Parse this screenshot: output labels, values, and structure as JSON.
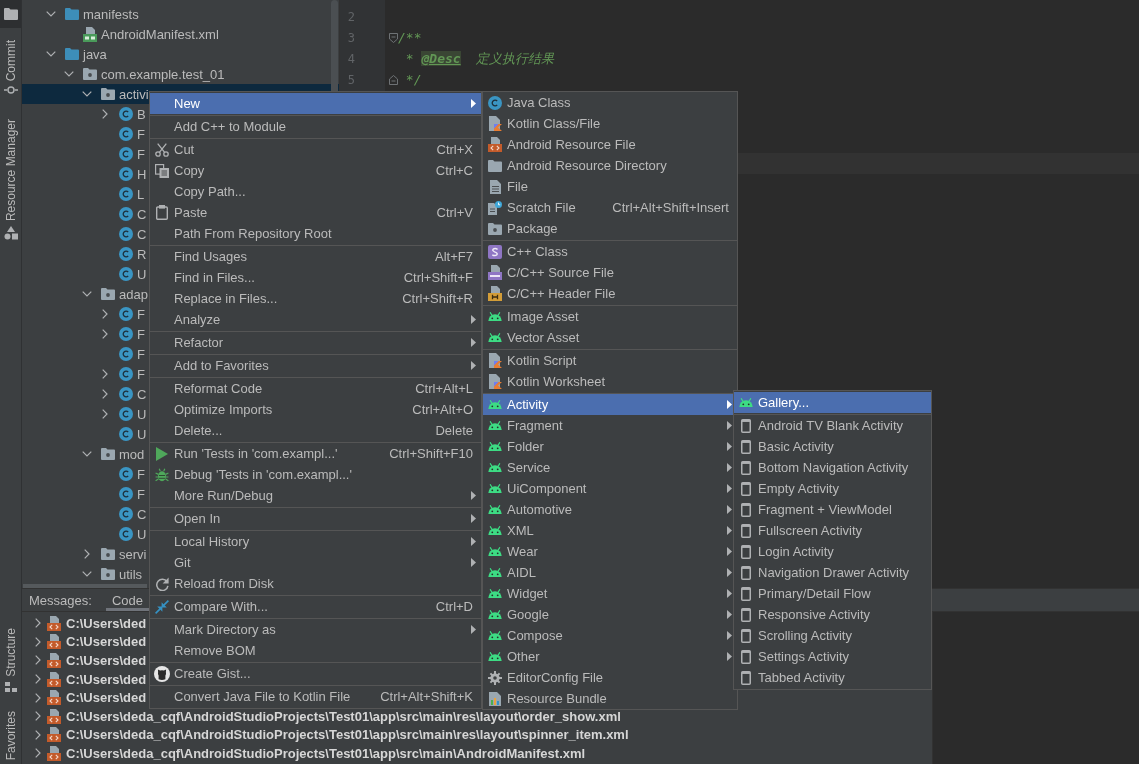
{
  "tool_strip": {
    "top": [
      {
        "kind": "project",
        "selected": true
      },
      {
        "kind": "commit",
        "label": "Commit",
        "selected": false
      },
      {
        "kind": "resources",
        "label": "Resource Manager",
        "selected": false
      }
    ],
    "bottom": [
      {
        "kind": "structure",
        "label": "Structure",
        "selected": false
      },
      {
        "kind": "favorites",
        "label": "Favorites",
        "selected": false
      }
    ]
  },
  "project_tree": {
    "items": [
      {
        "label": "manifests",
        "kind": "folder",
        "expanded": true,
        "selected": false,
        "children": [
          {
            "label": "AndroidManifest.xml",
            "kind": "manifest",
            "selected": false
          }
        ]
      },
      {
        "label": "java",
        "kind": "folder",
        "expanded": true,
        "selected": false,
        "children": [
          {
            "label": "com.example.test_01",
            "kind": "package",
            "expanded": true,
            "selected": false,
            "children": [
              {
                "label": "activi",
                "kind": "package",
                "expanded": true,
                "selected": true,
                "children": [
                  {
                    "label": "B",
                    "kind": "class",
                    "expanded": false,
                    "selected": false
                  },
                  {
                    "label": "F",
                    "kind": "class",
                    "selected": false
                  },
                  {
                    "label": "F",
                    "kind": "class",
                    "selected": false
                  },
                  {
                    "label": "H",
                    "kind": "class",
                    "selected": false
                  },
                  {
                    "label": "L",
                    "kind": "class",
                    "selected": false
                  },
                  {
                    "label": "C",
                    "kind": "class",
                    "selected": false
                  },
                  {
                    "label": "C",
                    "kind": "class",
                    "selected": false
                  },
                  {
                    "label": "R",
                    "kind": "class",
                    "selected": false
                  },
                  {
                    "label": "U",
                    "kind": "class",
                    "selected": false
                  }
                ]
              },
              {
                "label": "adap",
                "kind": "package",
                "expanded": true,
                "selected": false,
                "children": [
                  {
                    "label": "F",
                    "kind": "class",
                    "expanded": false,
                    "selected": false
                  },
                  {
                    "label": "F",
                    "kind": "class",
                    "expanded": false,
                    "selected": false
                  },
                  {
                    "label": "F",
                    "kind": "class",
                    "selected": false
                  },
                  {
                    "label": "F",
                    "kind": "class",
                    "expanded": false,
                    "selected": false
                  },
                  {
                    "label": "C",
                    "kind": "class",
                    "expanded": false,
                    "selected": false
                  },
                  {
                    "label": "U",
                    "kind": "class",
                    "expanded": false,
                    "selected": false
                  },
                  {
                    "label": "U",
                    "kind": "class",
                    "selected": false
                  }
                ]
              },
              {
                "label": "mod",
                "kind": "package",
                "expanded": true,
                "selected": false,
                "children": [
                  {
                    "label": "F",
                    "kind": "class",
                    "selected": false
                  },
                  {
                    "label": "F",
                    "kind": "class",
                    "selected": false
                  },
                  {
                    "label": "C",
                    "kind": "class",
                    "selected": false
                  },
                  {
                    "label": "U",
                    "kind": "class",
                    "selected": false
                  }
                ]
              },
              {
                "label": "servi",
                "kind": "package",
                "expanded": false,
                "selected": false
              },
              {
                "label": "utils",
                "kind": "package",
                "expanded": true,
                "selected": false
              }
            ]
          }
        ]
      }
    ]
  },
  "editor": {
    "lines": [
      {
        "number": "2",
        "fold_start": false,
        "fold_end": false
      },
      {
        "number": "3",
        "fold_start": true,
        "fold_end": false,
        "segments": [
          {
            "text": "/**",
            "kind": "comment"
          }
        ]
      },
      {
        "number": "4",
        "fold_start": false,
        "fold_end": false,
        "segments": [
          {
            "text": " * ",
            "kind": "comment"
          },
          {
            "text": "@Desc",
            "kind": "tag"
          },
          {
            "text": "  定义执行结果",
            "kind": "comment"
          }
        ]
      },
      {
        "number": "5",
        "fold_start": false,
        "fold_end": true,
        "segments": [
          {
            "text": " */",
            "kind": "comment"
          }
        ]
      }
    ]
  },
  "messages_panel": {
    "title": "Messages:",
    "tabs": [
      {
        "label": "Code",
        "selected": true
      }
    ],
    "rows": [
      {
        "text": "C:\\Users\\ded",
        "expanded": false
      },
      {
        "text": "C:\\Users\\ded",
        "expanded": false
      },
      {
        "text": "C:\\Users\\ded",
        "expanded": false
      },
      {
        "text": "C:\\Users\\ded",
        "expanded": false
      },
      {
        "text": "C:\\Users\\ded",
        "expanded": false
      },
      {
        "text": "C:\\Users\\deda_cqf\\AndroidStudioProjects\\Test01\\app\\src\\main\\res\\layout\\order_show.xml",
        "expanded": false
      },
      {
        "text": "C:\\Users\\deda_cqf\\AndroidStudioProjects\\Test01\\app\\src\\main\\res\\layout\\spinner_item.xml",
        "expanded": false
      },
      {
        "text": "C:\\Users\\deda_cqf\\AndroidStudioProjects\\Test01\\app\\src\\main\\AndroidManifest.xml",
        "expanded": false
      }
    ]
  },
  "context_menu": {
    "groups": [
      {
        "items": [
          {
            "label": "New",
            "kind": "plain",
            "selected": true,
            "submenu": true
          }
        ]
      },
      {
        "items": [
          {
            "label": "Add C++ to Module",
            "kind": "plain",
            "selected": false,
            "submenu": false
          }
        ]
      },
      {
        "items": [
          {
            "label": "Cut",
            "kind": "cut",
            "shortcut": "Ctrl+X",
            "selected": false,
            "submenu": false
          },
          {
            "label": "Copy",
            "kind": "copy",
            "shortcut": "Ctrl+C",
            "selected": false,
            "submenu": false
          },
          {
            "label": "Copy Path...",
            "kind": "plain",
            "selected": false,
            "submenu": false
          },
          {
            "label": "Paste",
            "kind": "paste",
            "shortcut": "Ctrl+V",
            "selected": false,
            "submenu": false
          },
          {
            "label": "Path From Repository Root",
            "kind": "plain",
            "selected": false,
            "submenu": false
          }
        ]
      },
      {
        "items": [
          {
            "label": "Find Usages",
            "kind": "plain",
            "shortcut": "Alt+F7",
            "selected": false,
            "submenu": false
          },
          {
            "label": "Find in Files...",
            "kind": "plain",
            "shortcut": "Ctrl+Shift+F",
            "selected": false,
            "submenu": false
          },
          {
            "label": "Replace in Files...",
            "kind": "plain",
            "shortcut": "Ctrl+Shift+R",
            "selected": false,
            "submenu": false
          },
          {
            "label": "Analyze",
            "kind": "plain",
            "selected": false,
            "submenu": true
          }
        ]
      },
      {
        "items": [
          {
            "label": "Refactor",
            "kind": "plain",
            "selected": false,
            "submenu": true
          }
        ]
      },
      {
        "items": [
          {
            "label": "Add to Favorites",
            "kind": "plain",
            "selected": false,
            "submenu": true
          }
        ]
      },
      {
        "items": [
          {
            "label": "Reformat Code",
            "kind": "plain",
            "shortcut": "Ctrl+Alt+L",
            "selected": false,
            "submenu": false
          },
          {
            "label": "Optimize Imports",
            "kind": "plain",
            "shortcut": "Ctrl+Alt+O",
            "selected": false,
            "submenu": false
          },
          {
            "label": "Delete...",
            "kind": "plain",
            "shortcut": "Delete",
            "selected": false,
            "submenu": false
          }
        ]
      },
      {
        "items": [
          {
            "label": "Run 'Tests in 'com.exampl...'",
            "kind": "run",
            "shortcut": "Ctrl+Shift+F10",
            "selected": false,
            "submenu": false
          },
          {
            "label": "Debug 'Tests in 'com.exampl...'",
            "kind": "debug",
            "selected": false,
            "submenu": false
          },
          {
            "label": "More Run/Debug",
            "kind": "plain",
            "selected": false,
            "submenu": true
          }
        ]
      },
      {
        "items": [
          {
            "label": "Open In",
            "kind": "plain",
            "selected": false,
            "submenu": true
          }
        ]
      },
      {
        "items": [
          {
            "label": "Local History",
            "kind": "plain",
            "selected": false,
            "submenu": true
          },
          {
            "label": "Git",
            "kind": "plain",
            "selected": false,
            "submenu": true
          },
          {
            "label": "Reload from Disk",
            "kind": "reload",
            "selected": false,
            "submenu": false
          }
        ]
      },
      {
        "items": [
          {
            "label": "Compare With...",
            "kind": "compare",
            "shortcut": "Ctrl+D",
            "selected": false,
            "submenu": false
          }
        ]
      },
      {
        "items": [
          {
            "label": "Mark Directory as",
            "kind": "plain",
            "selected": false,
            "submenu": true
          },
          {
            "label": "Remove BOM",
            "kind": "plain",
            "selected": false,
            "submenu": false
          }
        ]
      },
      {
        "items": [
          {
            "label": "Create Gist...",
            "kind": "gist",
            "selected": false,
            "submenu": false
          }
        ]
      },
      {
        "items": [
          {
            "label": "Convert Java File to Kotlin File",
            "kind": "plain",
            "shortcut": "Ctrl+Alt+Shift+K",
            "selected": false,
            "submenu": false
          }
        ]
      }
    ]
  },
  "new_submenu": {
    "groups": [
      {
        "items": [
          {
            "label": "Java Class",
            "kind": "class",
            "selected": false,
            "submenu": false
          },
          {
            "label": "Kotlin Class/File",
            "kind": "kotlin",
            "selected": false,
            "submenu": false
          },
          {
            "label": "Android Resource File",
            "kind": "resource",
            "selected": false,
            "submenu": false
          },
          {
            "label": "Android Resource Directory",
            "kind": "folder",
            "selected": false,
            "submenu": false
          },
          {
            "label": "File",
            "kind": "file",
            "selected": false,
            "submenu": false
          },
          {
            "label": "Scratch File",
            "kind": "scratch",
            "shortcut": "Ctrl+Alt+Shift+Insert",
            "selected": false,
            "submenu": false
          },
          {
            "label": "Package",
            "kind": "package",
            "selected": false,
            "submenu": false
          }
        ]
      },
      {
        "items": [
          {
            "label": "C++ Class",
            "kind": "cppclass",
            "selected": false,
            "submenu": false
          },
          {
            "label": "C/C++ Source File",
            "kind": "cppsource",
            "selected": false,
            "submenu": false
          },
          {
            "label": "C/C++ Header File",
            "kind": "cppheader",
            "selected": false,
            "submenu": false
          }
        ]
      },
      {
        "items": [
          {
            "label": "Image Asset",
            "kind": "android",
            "selected": false,
            "submenu": false
          },
          {
            "label": "Vector Asset",
            "kind": "android",
            "selected": false,
            "submenu": false
          }
        ]
      },
      {
        "items": [
          {
            "label": "Kotlin Script",
            "kind": "kotlin",
            "selected": false,
            "submenu": false
          },
          {
            "label": "Kotlin Worksheet",
            "kind": "kotlin",
            "selected": false,
            "submenu": false
          }
        ]
      },
      {
        "items": [
          {
            "label": "Activity",
            "kind": "android",
            "selected": true,
            "submenu": true
          },
          {
            "label": "Fragment",
            "kind": "android",
            "selected": false,
            "submenu": true
          },
          {
            "label": "Folder",
            "kind": "android",
            "selected": false,
            "submenu": true
          },
          {
            "label": "Service",
            "kind": "android",
            "selected": false,
            "submenu": true
          },
          {
            "label": "UiComponent",
            "kind": "android",
            "selected": false,
            "submenu": true
          },
          {
            "label": "Automotive",
            "kind": "android",
            "selected": false,
            "submenu": true
          },
          {
            "label": "XML",
            "kind": "android",
            "selected": false,
            "submenu": true
          },
          {
            "label": "Wear",
            "kind": "android",
            "selected": false,
            "submenu": true
          },
          {
            "label": "AIDL",
            "kind": "android",
            "selected": false,
            "submenu": true
          },
          {
            "label": "Widget",
            "kind": "android",
            "selected": false,
            "submenu": true
          },
          {
            "label": "Google",
            "kind": "android",
            "selected": false,
            "submenu": true
          },
          {
            "label": "Compose",
            "kind": "android",
            "selected": false,
            "submenu": true
          },
          {
            "label": "Other",
            "kind": "android",
            "selected": false,
            "submenu": true
          },
          {
            "label": "EditorConfig File",
            "kind": "config",
            "selected": false,
            "submenu": false
          },
          {
            "label": "Resource Bundle",
            "kind": "bundle",
            "selected": false,
            "submenu": false
          }
        ]
      }
    ]
  },
  "activity_submenu": {
    "groups": [
      {
        "items": [
          {
            "label": "Gallery...",
            "kind": "android",
            "selected": true,
            "submenu": false
          }
        ]
      },
      {
        "items": [
          {
            "label": "Android TV Blank Activity",
            "kind": "template",
            "selected": false,
            "submenu": false
          },
          {
            "label": "Basic Activity",
            "kind": "template",
            "selected": false,
            "submenu": false
          },
          {
            "label": "Bottom Navigation Activity",
            "kind": "template",
            "selected": false,
            "submenu": false
          },
          {
            "label": "Empty Activity",
            "kind": "template",
            "selected": false,
            "submenu": false
          },
          {
            "label": "Fragment + ViewModel",
            "kind": "template",
            "selected": false,
            "submenu": false
          },
          {
            "label": "Fullscreen Activity",
            "kind": "template",
            "selected": false,
            "submenu": false
          },
          {
            "label": "Login Activity",
            "kind": "template",
            "selected": false,
            "submenu": false
          },
          {
            "label": "Navigation Drawer Activity",
            "kind": "template",
            "selected": false,
            "submenu": false
          },
          {
            "label": "Primary/Detail Flow",
            "kind": "template",
            "selected": false,
            "submenu": false
          },
          {
            "label": "Responsive Activity",
            "kind": "template",
            "selected": false,
            "submenu": false
          },
          {
            "label": "Scrolling Activity",
            "kind": "template",
            "selected": false,
            "submenu": false
          },
          {
            "label": "Settings Activity",
            "kind": "template",
            "selected": false,
            "submenu": false
          },
          {
            "label": "Tabbed Activity",
            "kind": "template",
            "selected": false,
            "submenu": false
          }
        ]
      }
    ]
  }
}
